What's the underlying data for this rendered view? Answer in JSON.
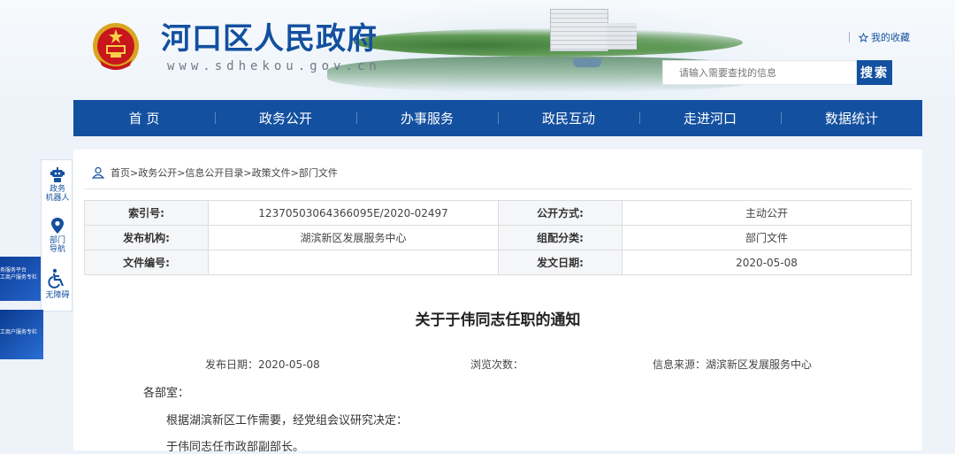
{
  "header": {
    "title": "河口区人民政府",
    "url": "www.sdhekou.gov.cn",
    "favorite": "我的收藏",
    "search_placeholder": "请输入需要查找的信息",
    "search_button": "搜索"
  },
  "nav": [
    "首 页",
    "政务公开",
    "办事服务",
    "政民互动",
    "走进河口",
    "数据统计"
  ],
  "left_float": [
    {
      "label": "政务\n机器人",
      "icon": "robot-icon"
    },
    {
      "label": "部门\n导航",
      "icon": "location-pin-icon"
    },
    {
      "label": "无障碍",
      "icon": "accessibility-icon"
    }
  ],
  "banners": {
    "a_line1": "务服务平台",
    "a_line2": "工商户服务专栏",
    "b_line1": "工商户服务专栏"
  },
  "breadcrumb": "首页>政务公开>信息公开目录>政策文件>部门文件",
  "meta": {
    "index_label": "索引号:",
    "index_value": "12370503064366095E/2020-02497",
    "method_label": "公开方式:",
    "method_value": "主动公开",
    "org_label": "发布机构:",
    "org_value": "湖滨新区发展服务中心",
    "category_label": "组配分类:",
    "category_value": "部门文件",
    "docno_label": "文件编号:",
    "docno_value": "",
    "date_label": "发文日期:",
    "date_value": "2020-05-08"
  },
  "doc": {
    "title": "关于于伟同志任职的通知",
    "publish_date": "发布日期：2020-05-08",
    "views": "浏览次数：",
    "source": "信息来源：湖滨新区发展服务中心",
    "salutation": "各部室：",
    "para1": "根据湖滨新区工作需要，经党组会议研究决定：",
    "para2": "于伟同志任市政部副部长。"
  },
  "colors": {
    "primary": "#13509f",
    "background": "#eef3f9"
  }
}
